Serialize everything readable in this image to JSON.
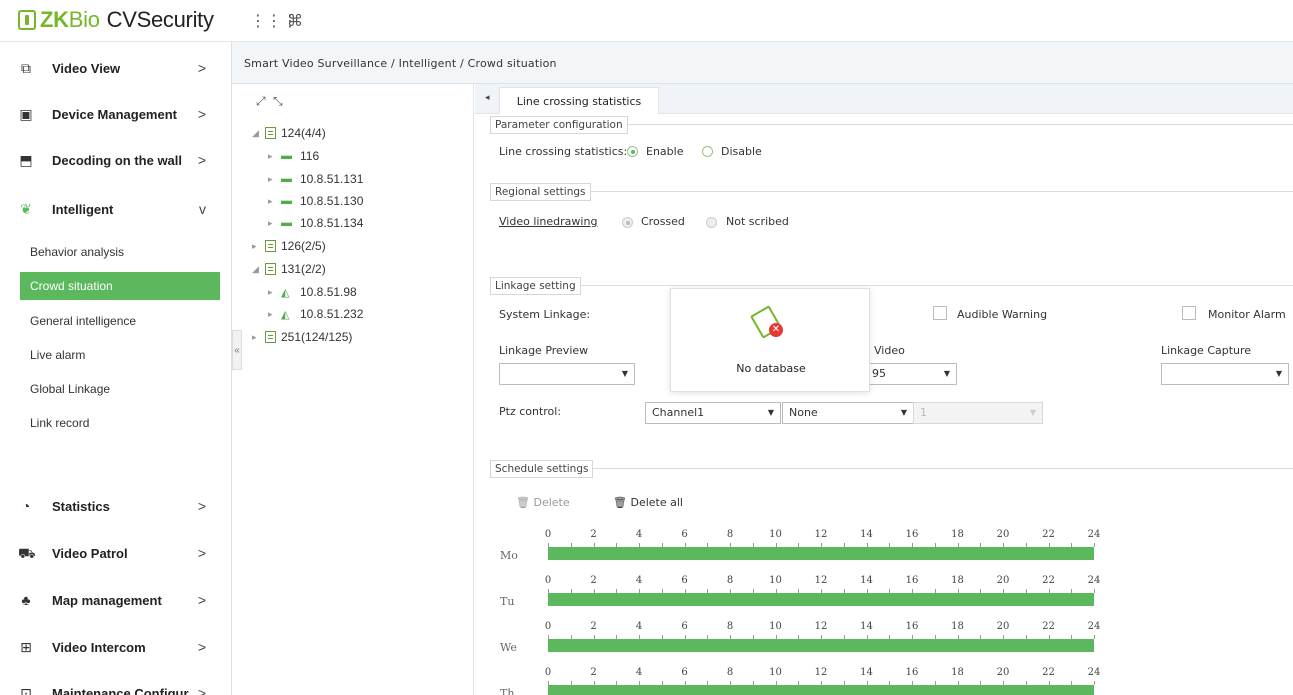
{
  "app": {
    "logo_zk": "ZK",
    "logo_bio": "Bio",
    "logo_rest": "CVSecurity",
    "icons": [
      "grid-icon",
      "command-icon"
    ]
  },
  "sidebar": {
    "items": [
      {
        "label": "Video View",
        "icon": "video-view-icon",
        "arrow": ">"
      },
      {
        "label": "Device Management",
        "icon": "device-icon",
        "arrow": ">"
      },
      {
        "label": "Decoding on the wall",
        "icon": "decoding-icon",
        "arrow": ">"
      },
      {
        "label": "Intelligent",
        "icon": "intelligent-icon",
        "arrow": "v"
      },
      {
        "label": "Statistics",
        "icon": "statistics-icon",
        "arrow": ">"
      },
      {
        "label": "Video Patrol",
        "icon": "patrol-icon",
        "arrow": ">"
      },
      {
        "label": "Map management",
        "icon": "map-icon",
        "arrow": ">"
      },
      {
        "label": "Video Intercom",
        "icon": "intercom-icon",
        "arrow": ">"
      },
      {
        "label": "Maintenance Configur...",
        "icon": "maintenance-icon",
        "arrow": ">"
      }
    ],
    "sub_items": [
      {
        "label": "Behavior analysis",
        "active": false
      },
      {
        "label": "Crowd situation",
        "active": true
      },
      {
        "label": "General intelligence",
        "active": false
      },
      {
        "label": "Live alarm",
        "active": false
      },
      {
        "label": "Global Linkage",
        "active": false
      },
      {
        "label": "Link record",
        "active": false
      }
    ],
    "collapse_glyph": "«"
  },
  "breadcrumb": "Smart Video Surveillance / Intelligent / Crowd situation",
  "tree": {
    "nodes": [
      {
        "label": "124(4/4)",
        "kind": "folder",
        "expanded": true
      },
      {
        "label": "116",
        "kind": "cam"
      },
      {
        "label": "10.8.51.131",
        "kind": "cam"
      },
      {
        "label": "10.8.51.130",
        "kind": "cam"
      },
      {
        "label": "10.8.51.134",
        "kind": "cam"
      },
      {
        "label": "126(2/5)",
        "kind": "folder",
        "expanded": false
      },
      {
        "label": "131(2/2)",
        "kind": "folder",
        "expanded": true
      },
      {
        "label": "10.8.51.98",
        "kind": "cam2"
      },
      {
        "label": "10.8.51.232",
        "kind": "cam2"
      },
      {
        "label": "251(124/125)",
        "kind": "folder",
        "expanded": false
      }
    ]
  },
  "tab": {
    "label": "Line crossing statistics"
  },
  "param": {
    "legend": "Parameter configuration",
    "label": "Line crossing statistics:",
    "enable": "Enable",
    "disable": "Disable",
    "selected": "Enable"
  },
  "regional": {
    "legend": "Regional settings",
    "link": "Video linedrawing",
    "crossed": "Crossed",
    "not_scribed": "Not scribed"
  },
  "linkage": {
    "legend": "Linkage setting",
    "system_linkage": "System Linkage:",
    "audible_warning": "Audible Warning",
    "monitor_alarm": "Monitor Alarm",
    "linkage_preview": "Linkage Preview",
    "video_label": "Video",
    "video_value": "95",
    "linkage_capture": "Linkage Capture",
    "ptz_label": "Ptz control:",
    "ptz_channel": "Channel1",
    "ptz_mode": "None",
    "ptz_value": "1"
  },
  "popup": {
    "text": "No database"
  },
  "schedule": {
    "legend": "Schedule settings",
    "delete": "Delete",
    "delete_all": "Delete all",
    "hours": [
      "0",
      "2",
      "4",
      "6",
      "8",
      "10",
      "12",
      "14",
      "16",
      "18",
      "20",
      "22",
      "24"
    ],
    "days": [
      "Mo",
      "Tu",
      "We",
      "Th"
    ],
    "bar_color": "#5cb85c"
  },
  "colors": {
    "accent": "#5cb85c",
    "brand": "#76b72a"
  }
}
